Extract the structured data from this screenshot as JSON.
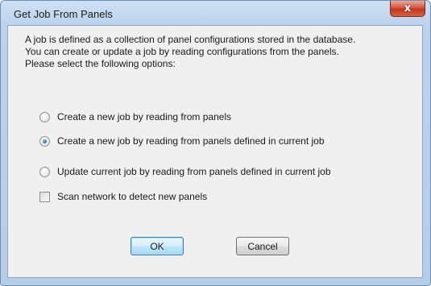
{
  "window": {
    "title": "Get Job From Panels",
    "close_glyph": "x",
    "close_icon": "close-icon"
  },
  "description": {
    "line1": "A job is defined as a collection of panel configurations stored in the database.",
    "line2": "You can create or update a job by reading configurations from the panels.",
    "line3": "Please select the following options:"
  },
  "options": [
    {
      "label": "Create a new job by reading from panels",
      "checked": false
    },
    {
      "label": "Create a new job by reading from panels defined in current job",
      "checked": true
    },
    {
      "label": "Update current job by reading from panels defined in current job",
      "checked": false
    }
  ],
  "scan_checkbox": {
    "label": "Scan network to detect new panels",
    "checked": false
  },
  "buttons": {
    "ok": "OK",
    "cancel": "Cancel"
  },
  "colors": {
    "titlebar": "#bdd3ec",
    "client_bg": "#f0f0f0",
    "close_red": "#c2361d",
    "default_button": "#bee6fd"
  }
}
